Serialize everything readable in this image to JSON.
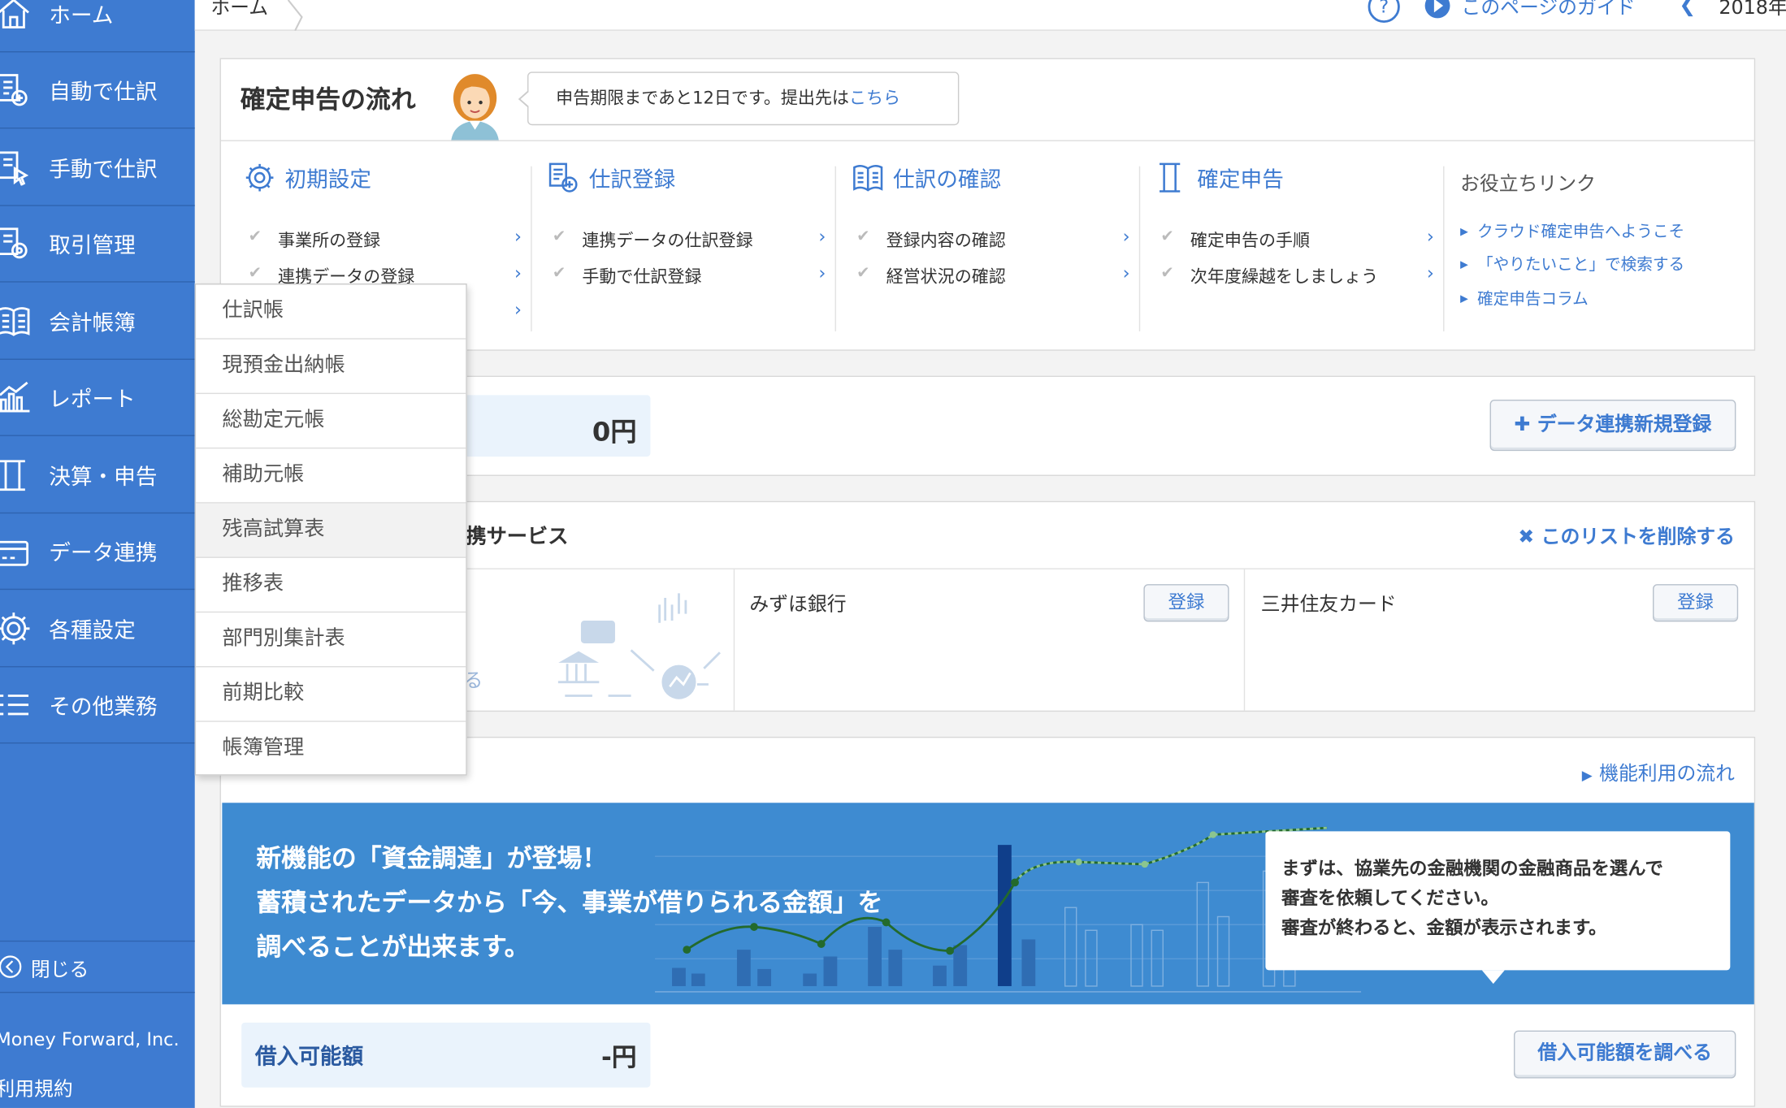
{
  "sidebar": {
    "items": [
      {
        "label": "ホーム",
        "icon": "home-icon"
      },
      {
        "label": "自動で仕訳",
        "icon": "auto-journal-icon"
      },
      {
        "label": "手動で仕訳",
        "icon": "manual-journal-icon"
      },
      {
        "label": "取引管理",
        "icon": "transactions-icon"
      },
      {
        "label": "会計帳簿",
        "icon": "ledger-book-icon"
      },
      {
        "label": "レポート",
        "icon": "report-chart-icon"
      },
      {
        "label": "決算・申告",
        "icon": "settlement-icon"
      },
      {
        "label": "データ連携",
        "icon": "data-link-icon"
      },
      {
        "label": "各種設定",
        "icon": "gear-icon"
      },
      {
        "label": "その他業務",
        "icon": "list-icon"
      }
    ],
    "close_label": "閉じる",
    "company": "Money Forward, Inc.",
    "terms": "利用規約",
    "accent": "#3e7bd1"
  },
  "header": {
    "breadcrumb": "ホーム",
    "guide_link": "このページのガイド",
    "year": "2018年"
  },
  "flow": {
    "title": "確定申告の流れ",
    "notice_text": "申告期限まであと12日です。提出先は",
    "notice_link": "こちら",
    "columns": [
      {
        "title": "初期設定",
        "icon": "gear-icon",
        "items": [
          "事業所の登録",
          "連携データの登録",
          ""
        ]
      },
      {
        "title": "仕訳登録",
        "icon": "journal-add-icon",
        "items": [
          "連携データの仕訳登録",
          "手動で仕訳登録"
        ]
      },
      {
        "title": "仕訳の確認",
        "icon": "book-icon",
        "items": [
          "登録内容の確認",
          "経営状況の確認"
        ]
      },
      {
        "title": "確定申告",
        "icon": "document-icon",
        "items": [
          "確定申告の手順",
          "次年度繰越をしましょう"
        ]
      }
    ],
    "useful": {
      "title": "お役立ちリンク",
      "links": [
        "クラウド確定申告へようこそ",
        "「やりたいこと」で検索する",
        "確定申告コラム"
      ]
    }
  },
  "balance": {
    "amount": "0円",
    "new_link_button": "データ連携新規登録"
  },
  "services": {
    "title": "携サービス",
    "delete_link": "このリストを削除する",
    "partial_text": "る",
    "entries": [
      {
        "name": "みずほ銀行",
        "button": "登録"
      },
      {
        "name": "三井住友カード",
        "button": "登録"
      }
    ]
  },
  "funding": {
    "flow_link": "機能利用の流れ",
    "banner_lines": [
      "新機能の「資金調達」が登場！",
      "蓄積されたデータから「今、事業が借りられる金額」を",
      "調べることが出来ます。"
    ],
    "callout_lines": [
      "まずは、協業先の金融機関の金融商品を選んで",
      "審査を依頼してください。",
      "審査が終わると、金額が表示されます。"
    ],
    "borrow_label": "借入可能額",
    "borrow_value": "-円",
    "check_button": "借入可能額を調べる"
  },
  "dropdown": {
    "items": [
      "仕訳帳",
      "現預金出納帳",
      "総勘定元帳",
      "補助元帳",
      "残高試算表",
      "推移表",
      "部門別集計表",
      "前期比較",
      "帳簿管理"
    ],
    "hovered": "残高試算表"
  }
}
